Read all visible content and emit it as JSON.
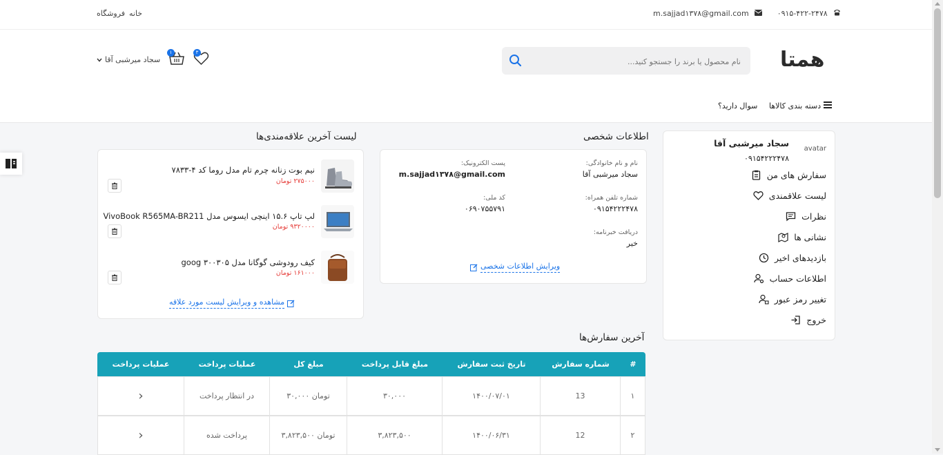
{
  "topbar": {
    "phone": "۰۹۱۵-۴۲۲-۲۴۷۸",
    "email": "m.sajjad۱۳۷۸@gmail.com",
    "nav": [
      "خانه",
      "فروشگاه"
    ]
  },
  "header": {
    "logo": "همتا",
    "search_placeholder": "نام محصول یا برند را جستجو کنید...",
    "wishlist_count": "۳",
    "cart_count": "۱",
    "user_name": "سجاد میرشبی آقا",
    "menu": {
      "categories": "دسته بندی کالاها",
      "faq": "سوال دارید؟"
    }
  },
  "profile": {
    "avatar_alt": "avatar",
    "name": "سجاد میرشبی آقا",
    "phone": "۰۹۱۵۴۲۲۲۴۷۸",
    "menu": [
      {
        "label": "سفارش های من",
        "icon": "clipboard-icon"
      },
      {
        "label": "لیست علاقمندی",
        "icon": "heart-icon"
      },
      {
        "label": "نظرات",
        "icon": "comment-icon"
      },
      {
        "label": "نشانی ها",
        "icon": "map-icon"
      },
      {
        "label": "بازدیدهای اخیر",
        "icon": "clock-icon"
      },
      {
        "label": "اطلاعات حساب",
        "icon": "user-gear-icon"
      },
      {
        "label": "تغییر رمز عبور",
        "icon": "user-lock-icon"
      },
      {
        "label": "خروج",
        "icon": "logout-icon"
      }
    ]
  },
  "personal_info": {
    "title": "اطلاعات شخصی",
    "fields": {
      "fullname_label": "نام و نام خانوادگی:",
      "fullname_value": "سجاد میرشبی آقا",
      "email_label": "پست الکترونیک:",
      "email_value": "m.sajjad۱۳۷۸@gmail.com",
      "mobile_label": "شماره تلفن همراه:",
      "mobile_value": "۰۹۱۵۴۲۲۲۴۷۸",
      "national_label": "کد ملی:",
      "national_value": "۰۶۹۰۷۵۵۷۹۱",
      "newsletter_label": "دریافت خبرنامه:",
      "newsletter_value": "خیر"
    },
    "edit_link": "ویرایش اطلاعات شخصی"
  },
  "wishlist": {
    "title": "لیست آخرین علاقه‌مندی‌ها",
    "items": [
      {
        "name": "نیم بوت زنانه چرم تام مدل روما کد ۴-۷۸۳۳",
        "price": "۲۷۵۰۰۰ تومان"
      },
      {
        "name": "لپ تاپ ۱۵.۶ اینچی ایسوس مدل VivoBook R565MA-BR211",
        "price": "۹۳۲۰۰۰۰ تومان"
      },
      {
        "name": "کیف رودوشی گوگانا مدل ۳۰۰۳۰۵ goog",
        "price": "۱۶۱۰۰۰ تومان"
      }
    ],
    "view_link": "مشاهده و ویرایش لیست مورد علاقه"
  },
  "orders": {
    "title": "آخرین سفارش‌ها",
    "headers": [
      "#",
      "شماره سفارش",
      "تاریخ ثبت سفارش",
      "مبلغ قابل پرداخت",
      "مبلغ کل",
      "عملیات پرداخت",
      "عملیات پرداخت"
    ],
    "rows": [
      {
        "idx": "۱",
        "number": "13",
        "date": "۱۴۰۰/۰۷/۰۱",
        "payable": "۳۰,۰۰۰",
        "total": "۳۰,۰۰۰ تومان",
        "status": "در انتظار پرداخت",
        "action": "›"
      },
      {
        "idx": "۲",
        "number": "12",
        "date": "۱۴۰۰/۰۶/۳۱",
        "payable": "۳,۸۲۳,۵۰۰",
        "total": "۳,۸۲۳,۵۰۰ تومان",
        "status": "پرداخت شده",
        "action": "›"
      }
    ]
  },
  "colors": {
    "accent": "#1a73e8",
    "table_header": "#17a2b8",
    "price": "#e53935"
  }
}
